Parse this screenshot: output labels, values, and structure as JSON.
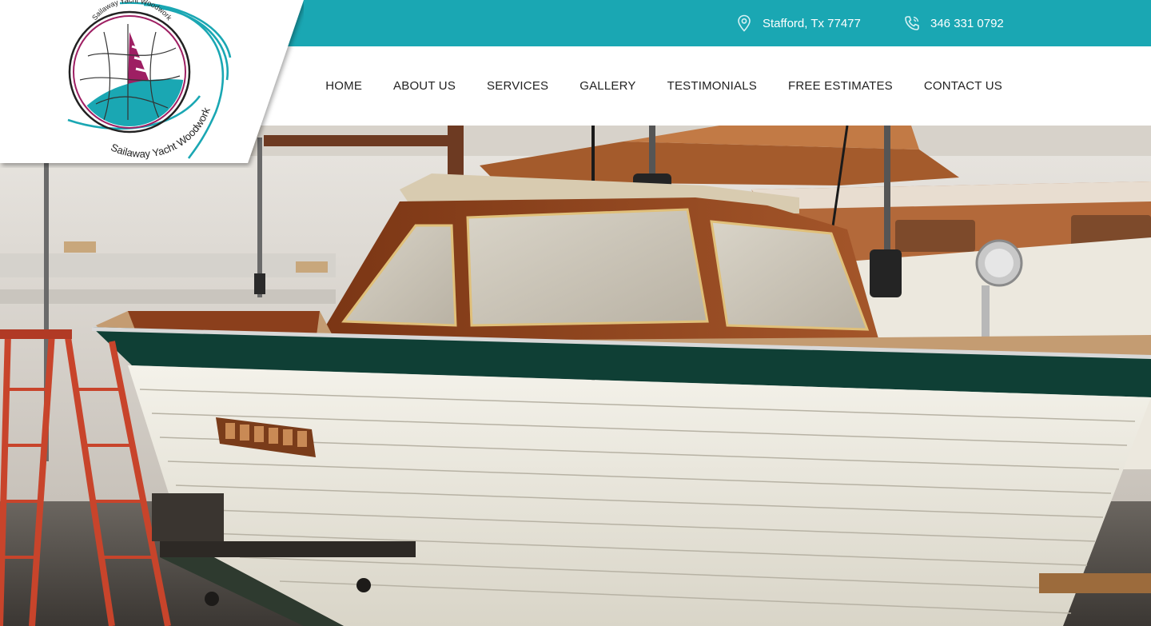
{
  "topbar": {
    "location_icon": "map-pin-icon",
    "location": "Stafford, Tx 77477",
    "phone_icon": "phone-icon",
    "phone": "346 331 0792",
    "color": "#1aa7b3"
  },
  "logo": {
    "inner_text": "Sailaway Yacht Woodwork",
    "outer_text": "Sailaway Yacht Woodwork"
  },
  "nav": {
    "items": [
      {
        "label": "HOME"
      },
      {
        "label": "ABOUT US"
      },
      {
        "label": "SERVICES"
      },
      {
        "label": "GALLERY"
      },
      {
        "label": "TESTIMONIALS"
      },
      {
        "label": "FREE ESTIMATES"
      },
      {
        "label": "CONTACT US"
      }
    ]
  },
  "colors": {
    "accent": "#1aa7b3",
    "brand_magenta": "#9e1f63"
  }
}
